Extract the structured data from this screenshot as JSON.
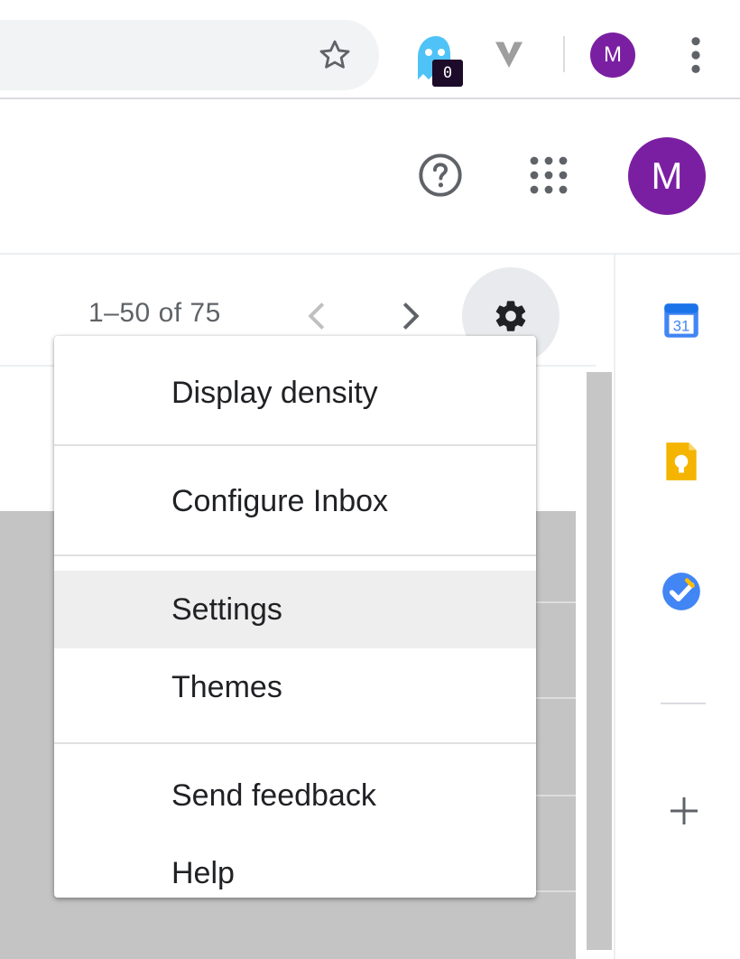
{
  "browser": {
    "extension_badge_count": "0",
    "profile_initial": "M"
  },
  "gmail_header": {
    "profile_initial": "M"
  },
  "list_toolbar": {
    "pager_text": "1–50 of 75"
  },
  "side_panel": {
    "calendar_day": "31"
  },
  "settings_menu": {
    "items": [
      {
        "label": "Display density"
      },
      {
        "label": "Configure Inbox"
      },
      {
        "label": "Settings",
        "highlighted": true
      },
      {
        "label": "Themes"
      },
      {
        "label": "Send feedback"
      },
      {
        "label": "Help"
      }
    ]
  },
  "colors": {
    "profile_purple": "#7b1fa2",
    "menu_highlight": "#eeeeee",
    "calendar_blue": "#4285f4",
    "keep_yellow": "#f4b400",
    "tasks_blue": "#4285f4"
  },
  "icons": [
    "star-icon",
    "ghost-extension-icon",
    "v-extension-icon",
    "kebab-menu-icon",
    "help-icon",
    "apps-grid-icon",
    "chevron-left-icon",
    "chevron-right-icon",
    "gear-icon",
    "calendar-icon",
    "keep-bulb-icon",
    "tasks-check-icon",
    "plus-icon"
  ]
}
